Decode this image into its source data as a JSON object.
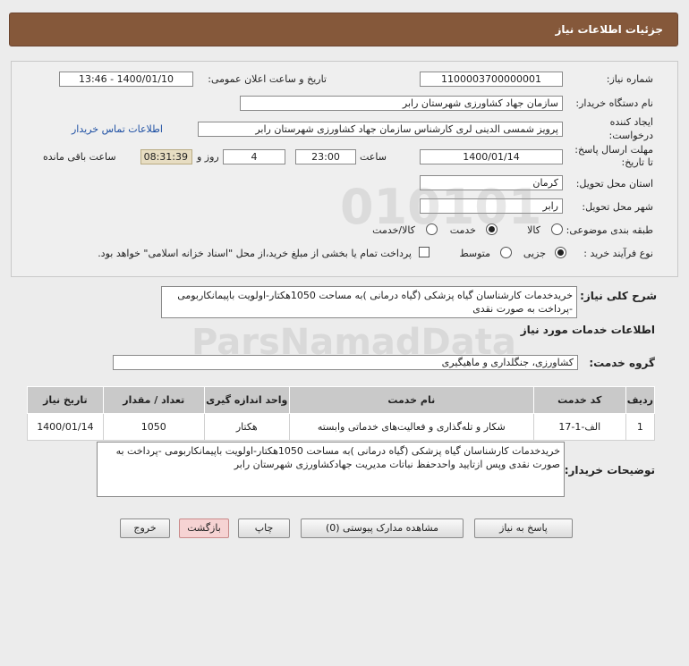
{
  "header": {
    "title": "جزئیات اطلاعات نیاز"
  },
  "labels": {
    "need_number": "شماره نیاز:",
    "announce_datetime": "تاریخ و ساعت اعلان عمومی:",
    "buyer_org": "نام دستگاه خریدار:",
    "requester_line1": "ایجاد کننده",
    "requester_line2": "درخواست:",
    "reply_deadline_line1": "مهلت ارسال پاسخ:",
    "reply_deadline_line2": "تا تاریخ:",
    "hour": "ساعت",
    "days_and": "روز و",
    "remaining": "ساعت باقی مانده",
    "province": "استان محل تحویل:",
    "city": "شهر محل تحویل:",
    "subject_class": "طبقه بندی موضوعی:",
    "purchase_type": "نوع فرآیند خرید :",
    "general_desc": "شرح کلی نیاز:",
    "services_info": "اطلاعات خدمات مورد نیاز",
    "service_group": "گروه خدمت:",
    "buyer_notes": "توضیحات خریدار:"
  },
  "values": {
    "need_number": "1100003700000001",
    "announce_datetime": "1400/01/10 - 13:46",
    "buyer_org": "سازمان جهاد کشاورزی شهرستان رابر",
    "requester": "پرویز  شمسی الدینی لری  کارشناس  سازمان جهاد کشاورزی شهرستان رابر",
    "contact_link": "اطلاعات تماس خریدار",
    "reply_date": "1400/01/14",
    "reply_time": "23:00",
    "days": "4",
    "remaining_time": "08:31:39",
    "province": "کرمان",
    "city": "رابر",
    "general_desc": "خریدخدمات کارشناسان گیاه پزشکی (گیاه درمانی )به مساحت 1050هکتار-اولویت باپیمانکاربومی -پرداخت به صورت نقدی",
    "service_group": "کشاورزی، جنگلداری و ماهیگیری",
    "buyer_notes": "خریدخدمات کارشناسان گیاه پزشکی (گیاه درمانی )به مساحت 1050هکتار-اولویت باپیمانکاربومی -پرداخت به صورت نقدی وپس ازتایید واحدحفظ نباتات مدیریت جهادکشاورزی شهرستان رابر"
  },
  "subject_options": [
    {
      "label": "کالا",
      "selected": false
    },
    {
      "label": "خدمت",
      "selected": true
    },
    {
      "label": "کالا/خدمت",
      "selected": false
    }
  ],
  "purchase_options": [
    {
      "label": "جزیی",
      "selected": true
    },
    {
      "label": "متوسط",
      "selected": false
    }
  ],
  "partial_payment": {
    "checked": false,
    "text": "پرداخت تمام یا بخشی از مبلغ خرید،از محل \"اسناد خزانه اسلامی\" خواهد بود."
  },
  "table": {
    "headers": [
      "ردیف",
      "کد خدمت",
      "نام خدمت",
      "واحد اندازه گیری",
      "تعداد / مقدار",
      "تاریخ نیاز"
    ],
    "rows": [
      [
        "1",
        "الف-1-17",
        "شکار و تله‌گذاری و فعالیت‌های خدماتی وابسته",
        "هکتار",
        "1050",
        "1400/01/14"
      ]
    ]
  },
  "buttons": {
    "reply": "پاسخ به نیاز",
    "view_docs": "مشاهده مدارک پیوستی (0)",
    "print": "چاپ",
    "back": "بازگشت",
    "exit": "خروج"
  },
  "watermark": {
    "brand": "ParsNamadData",
    "digits": "010101"
  },
  "colors": {
    "header_bg": "#85583a",
    "link": "#1d4fa3",
    "timer_bg": "#e7ddc2",
    "back_button": "#f6d3d3"
  }
}
